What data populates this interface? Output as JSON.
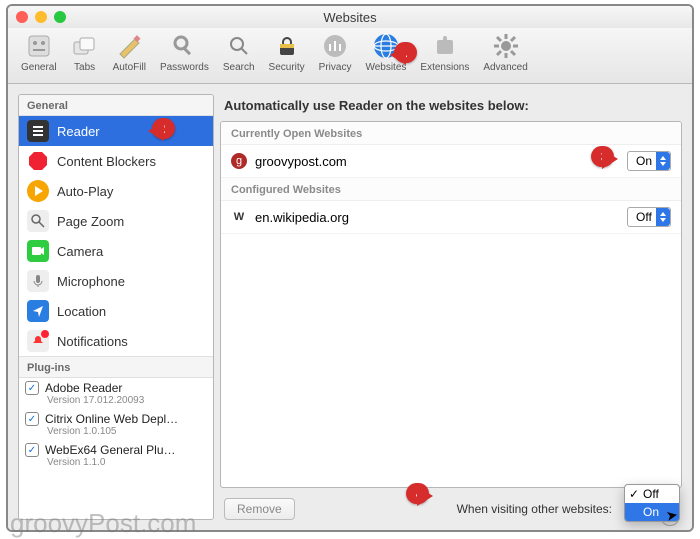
{
  "window": {
    "title": "Websites"
  },
  "toolbar": [
    {
      "id": "general",
      "label": "General"
    },
    {
      "id": "tabs",
      "label": "Tabs"
    },
    {
      "id": "autofill",
      "label": "AutoFill"
    },
    {
      "id": "passwords",
      "label": "Passwords"
    },
    {
      "id": "search",
      "label": "Search"
    },
    {
      "id": "security",
      "label": "Security"
    },
    {
      "id": "privacy",
      "label": "Privacy"
    },
    {
      "id": "websites",
      "label": "Websites"
    },
    {
      "id": "extensions",
      "label": "Extensions"
    },
    {
      "id": "advanced",
      "label": "Advanced"
    }
  ],
  "sidebar": {
    "section1_title": "General",
    "items": [
      {
        "id": "reader",
        "label": "Reader",
        "selected": true
      },
      {
        "id": "content-blockers",
        "label": "Content Blockers"
      },
      {
        "id": "auto-play",
        "label": "Auto-Play"
      },
      {
        "id": "page-zoom",
        "label": "Page Zoom"
      },
      {
        "id": "camera",
        "label": "Camera"
      },
      {
        "id": "microphone",
        "label": "Microphone"
      },
      {
        "id": "location",
        "label": "Location"
      },
      {
        "id": "notifications",
        "label": "Notifications",
        "badge": true
      }
    ],
    "section2_title": "Plug-ins",
    "plugins": [
      {
        "name": "Adobe Reader",
        "version": "Version 17.012.20093",
        "checked": true
      },
      {
        "name": "Citrix Online Web Depl…",
        "version": "Version 1.0.105",
        "checked": true
      },
      {
        "name": "WebEx64 General Plu…",
        "version": "Version 1.1.0",
        "checked": true
      }
    ]
  },
  "main": {
    "heading": "Automatically use Reader on the websites below:",
    "group1_title": "Currently Open Websites",
    "open_sites": [
      {
        "icon": "g",
        "icon_bg": "#b02a2a",
        "name": "groovypost.com",
        "value": "On"
      }
    ],
    "group2_title": "Configured Websites",
    "config_sites": [
      {
        "icon": "W",
        "icon_bg": "#666",
        "name": "en.wikipedia.org",
        "value": "Off"
      }
    ],
    "remove_label": "Remove",
    "other_label": "When visiting other websites:",
    "other_dropdown": {
      "options": [
        "Off",
        "On"
      ],
      "selected": "Off",
      "highlighted": "On"
    }
  },
  "callouts": {
    "c1": "1",
    "c2": "2",
    "c3": "3",
    "c4": "4"
  },
  "watermark": "groovyPost.com"
}
